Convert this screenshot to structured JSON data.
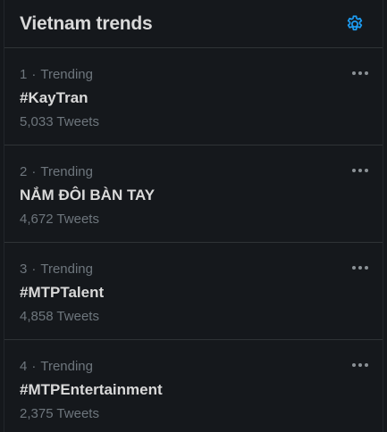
{
  "header": {
    "title": "Vietnam trends",
    "settings_icon": "gear-icon",
    "accent_color": "#1d9bf0"
  },
  "trends": [
    {
      "rank": "1",
      "category": "Trending",
      "name": "#KayTran",
      "tweets": "5,033 Tweets"
    },
    {
      "rank": "2",
      "category": "Trending",
      "name": "NẮM ĐÔI BÀN TAY",
      "tweets": "4,672 Tweets"
    },
    {
      "rank": "3",
      "category": "Trending",
      "name": "#MTPTalent",
      "tweets": "4,858 Tweets"
    },
    {
      "rank": "4",
      "category": "Trending",
      "name": "#MTPEntertainment",
      "tweets": "2,375 Tweets"
    }
  ],
  "more_icon": "more-horizontal-icon",
  "separator": "·"
}
